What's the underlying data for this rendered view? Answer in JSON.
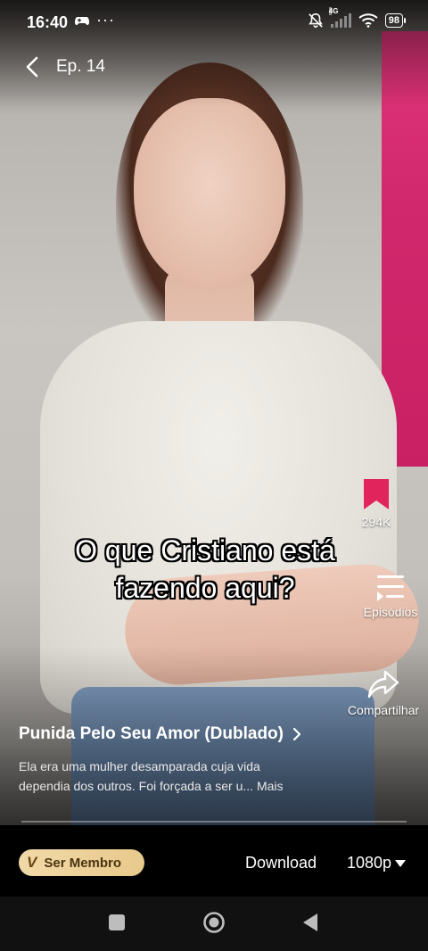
{
  "status_bar": {
    "time": "16:40",
    "overflow": "···",
    "network": "4G",
    "battery": "98"
  },
  "header": {
    "episode": "Ep. 14"
  },
  "subtitle": {
    "line1": "O que Cristiano está",
    "line2": "fazendo aqui?"
  },
  "actions": {
    "bookmark_count": "294K",
    "episodes_label": "Episódios",
    "share_label": "Compartilhar"
  },
  "drama": {
    "title": "Punida Pelo Seu Amor (Dublado)",
    "description_line1": "Ela era uma mulher desamparada cuja vida",
    "description_line2": "dependia dos outros. Foi forçada a ser u...",
    "more_label": "Mais"
  },
  "controls": {
    "member_badge": "V",
    "member_label": "Ser Membro",
    "download_label": "Download",
    "quality_label": "1080p"
  },
  "colors": {
    "bookmark": "#e2245c",
    "member_gradient_start": "#f1d9a8",
    "member_gradient_end": "#e8c98c"
  }
}
